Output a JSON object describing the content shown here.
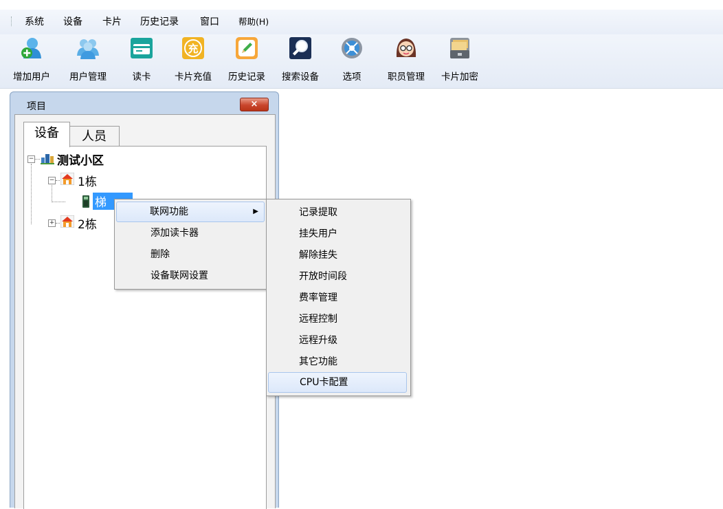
{
  "menu": [
    "系统",
    "设备",
    "卡片",
    "历史记录",
    "窗口",
    "帮助(H)"
  ],
  "toolbar": [
    {
      "label": "增加用户",
      "icon": "add-user-icon"
    },
    {
      "label": "用户管理",
      "icon": "user-management-icon"
    },
    {
      "label": "读卡",
      "icon": "read-card-icon"
    },
    {
      "label": "卡片充值",
      "icon": "card-recharge-icon"
    },
    {
      "label": "历史记录",
      "icon": "history-icon"
    },
    {
      "label": "搜索设备",
      "icon": "search-device-icon"
    },
    {
      "label": "选项",
      "icon": "options-icon"
    },
    {
      "label": "职员管理",
      "icon": "staff-management-icon"
    },
    {
      "label": "卡片加密",
      "icon": "card-encrypt-icon"
    }
  ],
  "panel": {
    "title": "项目",
    "close_icon": "×",
    "tabs": [
      "设备",
      "人员"
    ],
    "tree": {
      "root": "测试小区",
      "building1": "1栋",
      "device": "梯",
      "building2": "2栋"
    }
  },
  "context_menu": {
    "items": [
      "联网功能",
      "添加读卡器",
      "删除",
      "设备联网设置"
    ],
    "submenu_arrow": "▶"
  },
  "submenu": {
    "items": [
      "记录提取",
      "挂失用户",
      "解除挂失",
      "开放时间段",
      "费率管理",
      "远程控制",
      "远程升级",
      "其它功能",
      "CPU卡配置"
    ]
  },
  "colors": {
    "panel_frame": "#c6d7ec",
    "highlight": "#3399ff",
    "close_button": "#c9452c"
  }
}
